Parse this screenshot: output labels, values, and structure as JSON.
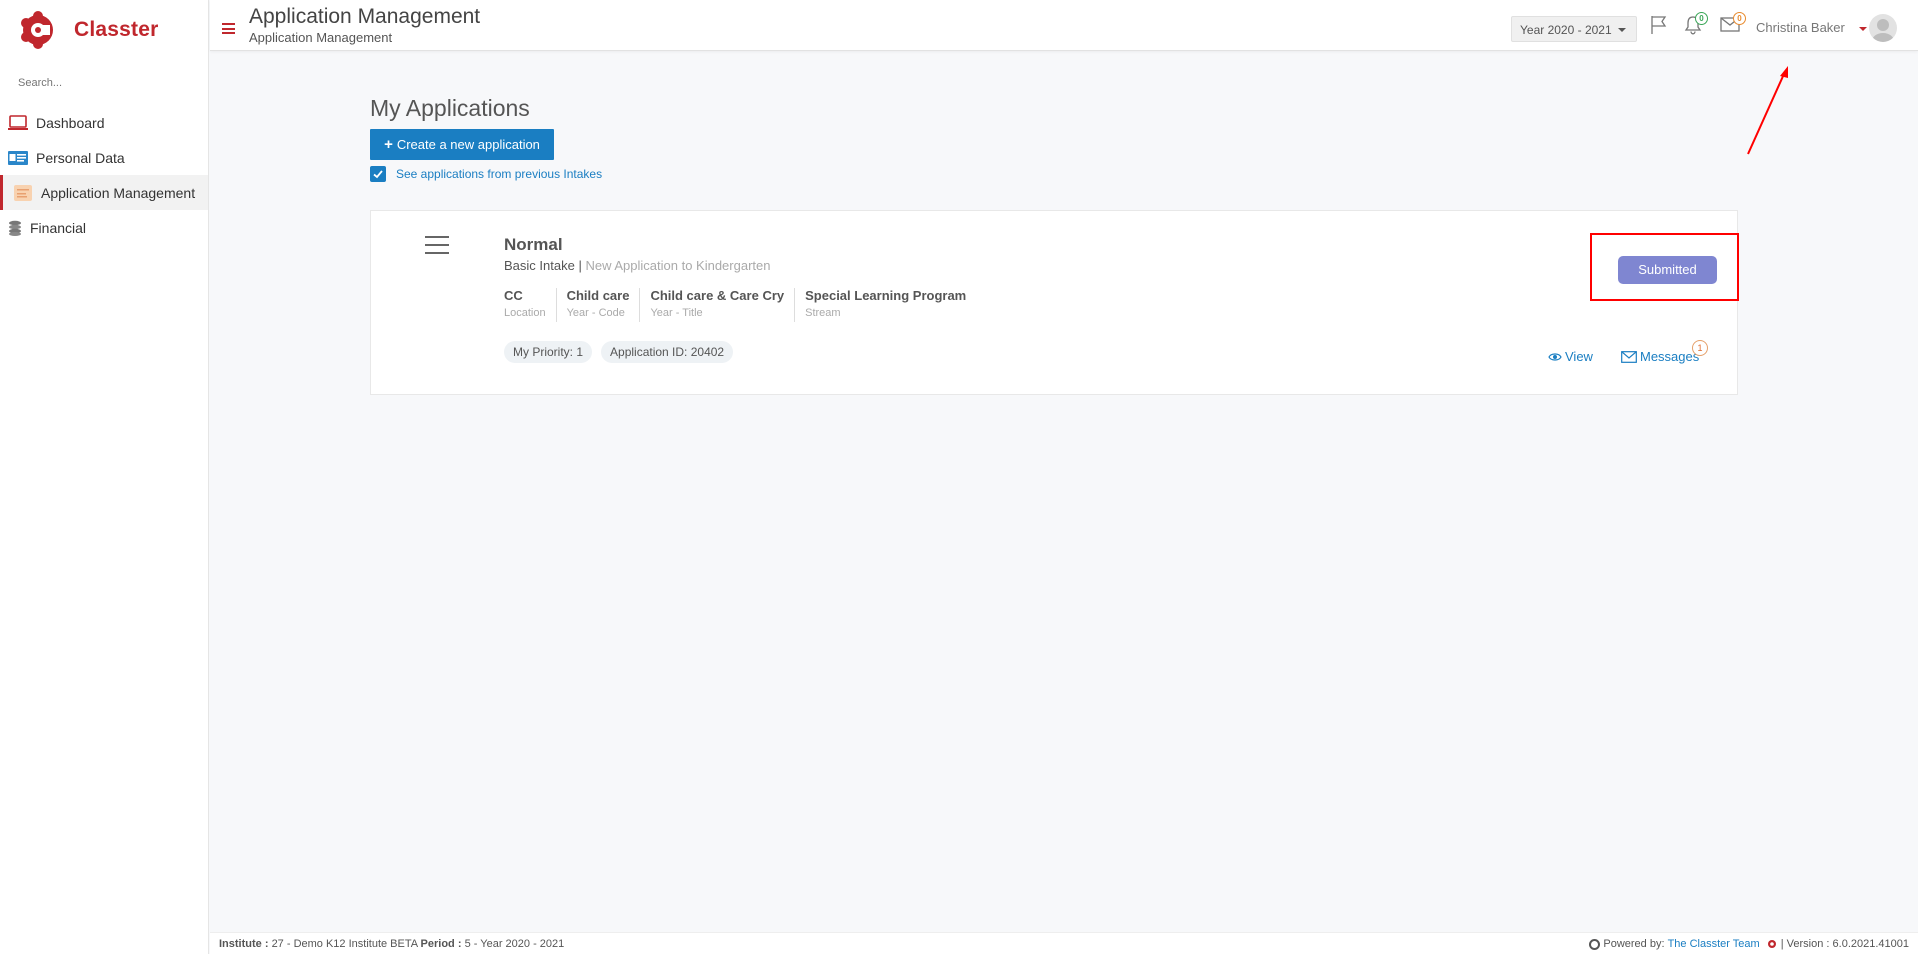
{
  "brand": {
    "name": "Classter",
    "accent": "#c0272d"
  },
  "sidebar": {
    "search_placeholder": "Search...",
    "items": [
      {
        "label": "Dashboard",
        "icon": "laptop-icon"
      },
      {
        "label": "Personal Data",
        "icon": "id-card-icon"
      },
      {
        "label": "Application Management",
        "icon": "application-icon",
        "active": true
      },
      {
        "label": "Financial",
        "icon": "coins-icon"
      }
    ]
  },
  "header": {
    "title": "Application Management",
    "subtitle": "Application Management",
    "year": "Year 2020 - 2021",
    "notifications_count": "0",
    "messages_count": "0",
    "user_name": "Christina Baker"
  },
  "main": {
    "title": "My Applications",
    "create_label": "Create a new application",
    "previous_intakes_label": "See applications from previous Intakes",
    "previous_intakes_checked": true
  },
  "application": {
    "title": "Normal",
    "intake": "Basic Intake",
    "separator": "|",
    "description": "New Application to Kindergarten",
    "details": [
      {
        "value": "CC",
        "label": "Location"
      },
      {
        "value": "Child care",
        "label": "Year - Code"
      },
      {
        "value": "Child care & Care Cry",
        "label": "Year - Title"
      },
      {
        "value": "Special Learning Program",
        "label": "Stream"
      }
    ],
    "priority": "My Priority: 1",
    "application_id": "Application ID: 20402",
    "status": "Submitted",
    "status_color": "#7f86d1",
    "view_label": "View",
    "messages_label": "Messages",
    "messages_count": "1"
  },
  "footer": {
    "institute_label": "Institute :",
    "institute_value": "27 - Demo K12 Institute BETA",
    "period_label": "Period :",
    "period_value": "5 - Year 2020 - 2021",
    "powered_by": "Powered by:",
    "team": "The Classter Team",
    "version": "| Version : 6.0.2021.41001"
  }
}
